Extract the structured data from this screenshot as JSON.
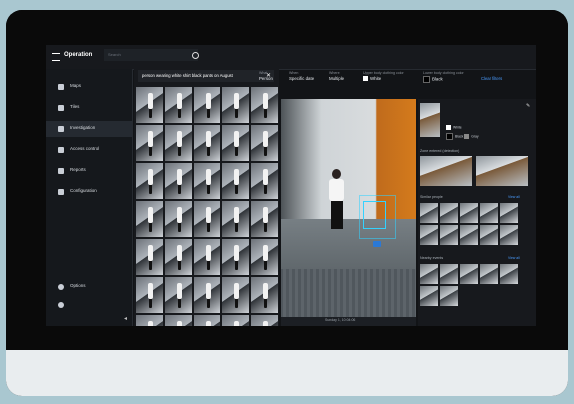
{
  "app": {
    "title": "Operation",
    "search_placeholder": "Search"
  },
  "sidebar": {
    "items": [
      {
        "label": "Maps",
        "active": false
      },
      {
        "label": "Tiles",
        "active": false
      },
      {
        "label": "Investigation",
        "active": true
      },
      {
        "label": "Access control",
        "active": false
      },
      {
        "label": "Reports",
        "active": false
      },
      {
        "label": "Configuration",
        "active": false
      }
    ],
    "bottom": {
      "options_label": "Options"
    }
  },
  "search": {
    "query": "person wearing white shirt black pants on August"
  },
  "filters": {
    "what": {
      "label": "What",
      "value": "Person"
    },
    "when": {
      "label": "When",
      "value": "Specific date"
    },
    "where": {
      "label": "Where",
      "value": "Multiple"
    },
    "upper": {
      "label": "Upper body clothing color",
      "value": "White"
    },
    "lower": {
      "label": "Lower body clothing color",
      "value": "Black"
    },
    "clear": "Clear filters"
  },
  "panel": {
    "headings": {
      "similar": "Similar people",
      "nearby": "Nearby events",
      "zone": "Zone entered (detection)"
    },
    "view_all": "View all",
    "colors": {
      "upper": "White",
      "lower_a": "Black",
      "lower_b": "Gray"
    }
  },
  "video": {
    "timestamp": "Sunday 1, 10:04:06"
  }
}
